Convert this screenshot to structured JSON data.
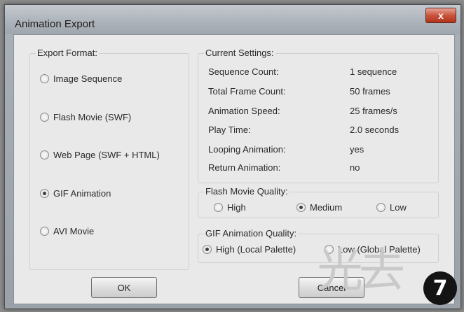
{
  "window": {
    "title": "Animation Export",
    "close_glyph": "x"
  },
  "export_format": {
    "legend": "Export Format:",
    "options": [
      {
        "label": "Image Sequence",
        "selected": false
      },
      {
        "label": "Flash Movie (SWF)",
        "selected": false
      },
      {
        "label": "Web Page (SWF + HTML)",
        "selected": false
      },
      {
        "label": "GIF Animation",
        "selected": true
      },
      {
        "label": "AVI Movie",
        "selected": false
      }
    ]
  },
  "current_settings": {
    "legend": "Current Settings:",
    "rows": [
      {
        "label": "Sequence Count:",
        "value": "1 sequence"
      },
      {
        "label": "Total Frame Count:",
        "value": "50 frames"
      },
      {
        "label": "Animation Speed:",
        "value": "25 frames/s"
      },
      {
        "label": "Play Time:",
        "value": "2.0 seconds"
      },
      {
        "label": "Looping Animation:",
        "value": "yes"
      },
      {
        "label": "Return Animation:",
        "value": "no"
      }
    ]
  },
  "flash_quality": {
    "legend": "Flash Movie Quality:",
    "options": [
      {
        "label": "High",
        "selected": false
      },
      {
        "label": "Medium",
        "selected": true
      },
      {
        "label": "Low",
        "selected": false
      }
    ]
  },
  "gif_quality": {
    "legend": "GIF Animation Quality:",
    "options": [
      {
        "label": "High (Local Palette)",
        "selected": true
      },
      {
        "label": "Low (Global Palette)",
        "selected": false
      }
    ]
  },
  "buttons": {
    "ok": "OK",
    "cancel": "Cancel"
  },
  "overlay": {
    "step_number": "7",
    "watermark_text": "光去"
  }
}
